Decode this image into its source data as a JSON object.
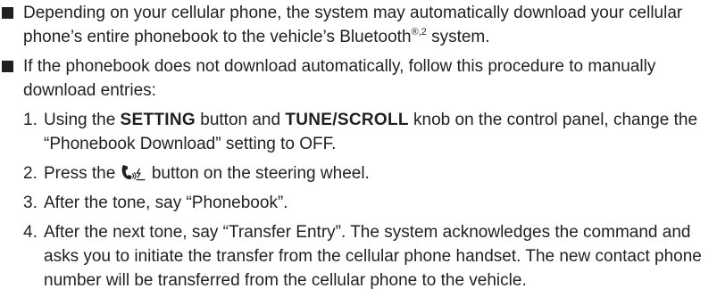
{
  "bullets": [
    {
      "text_before": "Depending on your cellular phone, the system may automatically download your cellular phone’s entire phonebook to the vehicle’s Bluetooth",
      "superscript": "®,2",
      "text_after": " system."
    },
    {
      "text": "If the phonebook does not download automatically, follow this procedure to manually download entries:",
      "steps": [
        {
          "number": "1.",
          "part1": "Using the ",
          "keyword1": "SETTING",
          "part2": " button and ",
          "keyword2": "TUNE/SCROLL",
          "part3": " knob on the control panel, change the “Phonebook Download” setting to OFF."
        },
        {
          "number": "2.",
          "before_icon": "Press the ",
          "icon": "phone-voice-icon",
          "after_icon": " button on the steering wheel."
        },
        {
          "number": "3.",
          "text": "After the tone, say “Phonebook”."
        },
        {
          "number": "4.",
          "text": "After the next tone, say “Transfer Entry”. The system acknowledges the command and asks you to initiate the transfer from the cellular phone handset. The new contact phone number will be transferred from the cellular phone to the vehicle."
        }
      ]
    }
  ]
}
